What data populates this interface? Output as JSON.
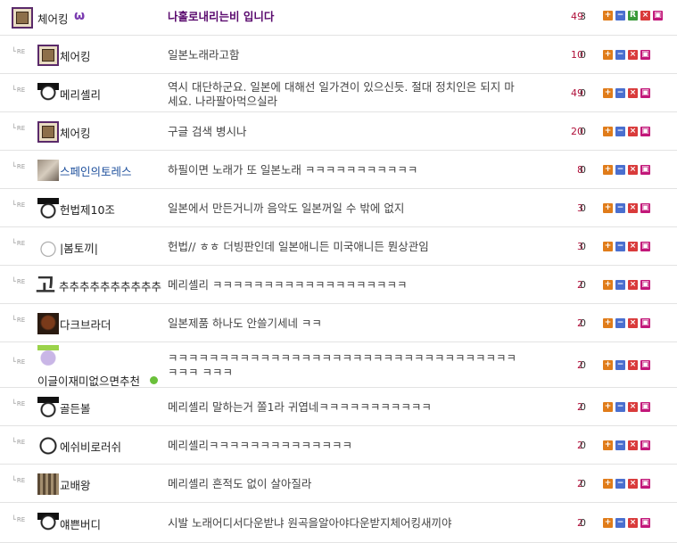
{
  "rows": [
    {
      "re": false,
      "nick": "체어킹",
      "title": "나홀로내리는비 입니다",
      "count": "49",
      "sub": "3",
      "buttons": [
        "+",
        "−",
        "R",
        "×",
        "🔒"
      ]
    },
    {
      "re": true,
      "nick": "체어킹",
      "title": "일본노래라고함",
      "count": "10",
      "sub": "0",
      "buttons": [
        "+",
        "−",
        "×",
        "🔒"
      ]
    },
    {
      "re": true,
      "nick": "메리셸리",
      "title": "역시 대단하군요. 일본에 대해선 일가견이 있으신듯. 절대 정치인은 되지 마세요. 나라팔아먹으실라",
      "count": "49",
      "sub": "0",
      "buttons": [
        "+",
        "−",
        "×",
        "🔒"
      ]
    },
    {
      "re": true,
      "nick": "체어킹",
      "title": "구글 검색 병시나",
      "count": "20",
      "sub": "0",
      "buttons": [
        "+",
        "−",
        "×",
        "🔒"
      ]
    },
    {
      "re": true,
      "nick": "스페인의토레스",
      "title": "하필이면 노래가 또 일본노래 ㅋㅋㅋㅋㅋㅋㅋㅋㅋㅋㅋ",
      "count": "8",
      "sub": "0",
      "buttons": [
        "+",
        "−",
        "×",
        "🔒"
      ]
    },
    {
      "re": true,
      "nick": "헌법제10조",
      "title": "일본에서 만든거니까 음악도 일본꺼일 수 밖에 없지",
      "count": "3",
      "sub": "0",
      "buttons": [
        "+",
        "−",
        "×",
        "🔒"
      ]
    },
    {
      "re": true,
      "nick": "|봄토끼|",
      "title": "헌법// ㅎㅎ 더빙판인데 일본애니든 미국애니든 뭔상관임",
      "count": "3",
      "sub": "0",
      "buttons": [
        "+",
        "−",
        "×",
        "🔒"
      ]
    },
    {
      "re": true,
      "nick": "추추추추추추추추추추",
      "title": "메리셸리 ㅋㅋㅋㅋㅋㅋㅋㅋㅋㅋㅋㅋㅋㅋㅋㅋㅋㅋㅋ",
      "count": "2",
      "sub": "0",
      "buttons": [
        "+",
        "−",
        "×",
        "🔒"
      ]
    },
    {
      "re": true,
      "nick": "다크브라더",
      "title": "일본제품 하나도 안쓸기세네 ㅋㅋ",
      "count": "2",
      "sub": "0",
      "buttons": [
        "+",
        "−",
        "×",
        "🔒"
      ]
    },
    {
      "re": true,
      "nick": "이글이재미없으면추천",
      "title": "ㅋㅋㅋㅋㅋㅋㅋㅋㅋㅋㅋㅋㅋㅋㅋㅋㅋㅋㅋㅋㅋㅋㅋㅋㅋㅋㅋㅋㅋㅋㅋㅋㅋㅋㅋㅋㅋ ㅋㅋㅋ",
      "count": "2",
      "sub": "0",
      "buttons": [
        "+",
        "−",
        "×",
        "🔒"
      ]
    },
    {
      "re": true,
      "nick": "골든볼",
      "title": "메리셸리 말하는거 쫄1라 귀엽네ㅋㅋㅋㅋㅋㅋㅋㅋㅋㅋㅋ",
      "count": "2",
      "sub": "0",
      "buttons": [
        "+",
        "−",
        "×",
        "🔒"
      ]
    },
    {
      "re": true,
      "nick": "에쉬비로러쉬",
      "title": "메리셸리ㅋㅋㅋㅋㅋㅋㅋㅋㅋㅋㅋㅋㅋㅋ",
      "count": "2",
      "sub": "0",
      "buttons": [
        "+",
        "−",
        "×",
        "🔒"
      ]
    },
    {
      "re": true,
      "nick": "교배왕",
      "title": "메리셸리 흔적도 없이 살아질라",
      "count": "2",
      "sub": "0",
      "buttons": [
        "+",
        "−",
        "×",
        "🔒"
      ]
    },
    {
      "re": true,
      "nick": "얘쁜버디",
      "title": "시발 노래어디서다운받냐 원곡을알아야다운받지체어킹새끼야",
      "count": "2",
      "sub": "0",
      "buttons": [
        "+",
        "−",
        "×",
        "🔒"
      ]
    }
  ],
  "re_label": "RE",
  "big_char": "고"
}
